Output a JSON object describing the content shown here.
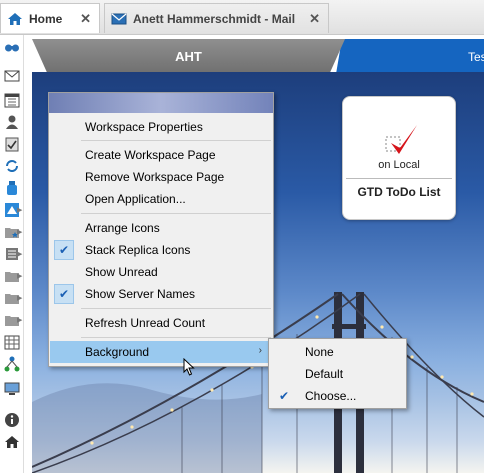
{
  "tabs": [
    {
      "label": "Home",
      "icon": "home-icon",
      "active": true
    },
    {
      "label": "Anett Hammerschmidt - Mail",
      "icon": "mail-icon",
      "active": false
    }
  ],
  "workspace_tabs": [
    {
      "label": "AHT",
      "active": true
    },
    {
      "label": "Tes",
      "active": false
    }
  ],
  "replica_card": {
    "location": "on Local",
    "title": "GTD ToDo List",
    "icon": "checkmark-icon"
  },
  "context_menu": {
    "items": [
      {
        "label": "Workspace Properties",
        "checked": false
      },
      {
        "label": "Create Workspace Page",
        "checked": false
      },
      {
        "label": "Remove Workspace Page",
        "checked": false
      },
      {
        "label": "Open Application...",
        "checked": false
      },
      {
        "label": "Arrange Icons",
        "checked": false
      },
      {
        "label": "Stack Replica Icons",
        "checked": true
      },
      {
        "label": "Show Unread",
        "checked": false
      },
      {
        "label": "Show Server Names",
        "checked": true
      },
      {
        "label": "Refresh Unread Count",
        "checked": false
      },
      {
        "label": "Background",
        "checked": false,
        "submenu": true,
        "highlighted": true
      }
    ]
  },
  "background_submenu": {
    "items": [
      {
        "label": "None",
        "checked": false
      },
      {
        "label": "Default",
        "checked": false
      },
      {
        "label": "Choose...",
        "checked": true
      }
    ]
  },
  "rail_icons": [
    "contacts-icon",
    "mail-icon",
    "calendar-icon",
    "person-icon",
    "todo-icon",
    "replication-icon",
    "bottle-icon",
    "workspace-icon",
    "favorites-folder-icon",
    "databases-icon",
    "folder-icon",
    "folder-icon",
    "folder-icon",
    "calendar-grid-icon",
    "network-icon",
    "screen-icon",
    "info-icon",
    "home-icon"
  ],
  "colors": {
    "menu_highlight": "#99c9ef",
    "active_tab": "#7f7f7f",
    "second_tab": "#1565c0"
  }
}
